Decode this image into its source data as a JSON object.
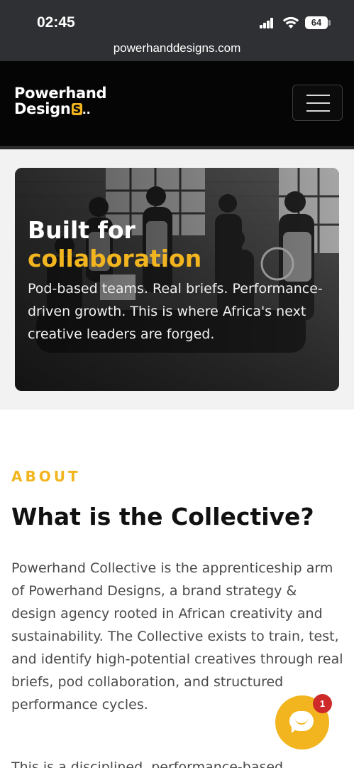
{
  "status_bar": {
    "time": "02:45",
    "battery": "64",
    "icons": [
      "signal-icon",
      "wifi-icon",
      "battery-icon"
    ]
  },
  "browser": {
    "url": "powerhanddesigns.com"
  },
  "site_header": {
    "logo_line1": "Powerhand",
    "logo_line2": "Design",
    "logo_mark": "S",
    "logo_dots": "..",
    "menu_icon": "hamburger-menu-icon"
  },
  "hero": {
    "title_line1": "Built for",
    "title_line2": "collaboration",
    "description": "Pod-based teams. Real briefs. Performance-driven growth. This is where Africa's next creative leaders are forged."
  },
  "about": {
    "eyebrow": "ABOUT",
    "title": "What is the Collective?",
    "body": "Powerhand Collective is the apprenticeship arm of Powerhand Designs, a brand strategy & design agency rooted in African creativity and sustainability. The Collective exists to train, test, and identify high-potential creatives through real briefs, pod collaboration, and structured performance cycles.",
    "body_2": "This is a disciplined, performance-based"
  },
  "chat_widget": {
    "badge_count": "1",
    "icon": "chat-bubble-icon"
  },
  "colors": {
    "accent": "#f2b51f",
    "header_bg": "#050505",
    "status_bar_bg": "#2f3033",
    "badge": "#cf2a2a"
  }
}
